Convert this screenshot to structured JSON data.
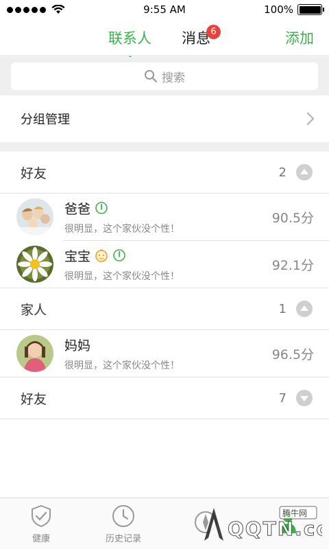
{
  "status_bar": {
    "time": "9:55 AM",
    "battery": "100%",
    "battery_level": 1.0
  },
  "navbar": {
    "tabs": [
      {
        "label": "联系人",
        "active": true
      },
      {
        "label": "消息",
        "active": false,
        "badge": "6"
      }
    ],
    "add_label": "添加"
  },
  "search": {
    "placeholder": "搜索"
  },
  "group_manage": {
    "label": "分组管理"
  },
  "groups": [
    {
      "name": "好友",
      "count": "2",
      "expanded": true,
      "contacts": [
        {
          "name": "爸爸",
          "status": "很明显，这个家伙没个性！",
          "score": "90.5分",
          "icons": [
            "gauge-icon"
          ]
        },
        {
          "name": "宝宝",
          "status": "很明显，这个家伙没个性！",
          "score": "92.1分",
          "icons": [
            "baby-face-icon",
            "gauge-icon"
          ]
        }
      ]
    },
    {
      "name": "家人",
      "count": "1",
      "expanded": true,
      "contacts": [
        {
          "name": "妈妈",
          "status": "很明显，这个家伙没个性！",
          "score": "96.5分",
          "icons": []
        }
      ]
    },
    {
      "name": "好友",
      "count": "7",
      "expanded": false,
      "contacts": []
    }
  ],
  "tabbar": {
    "items": [
      {
        "label": "健康",
        "icon": "shield-check-icon"
      },
      {
        "label": "历史记录",
        "icon": "clock-icon"
      },
      {
        "label": "",
        "icon": "compass-icon"
      },
      {
        "label": "",
        "icon": "contacts-icon"
      }
    ]
  },
  "watermark": {
    "text": "腾牛网",
    "logo": "QQTN.com"
  },
  "colors": {
    "accent": "#39b54a",
    "badge": "#e8423a",
    "background": "#efefef"
  }
}
